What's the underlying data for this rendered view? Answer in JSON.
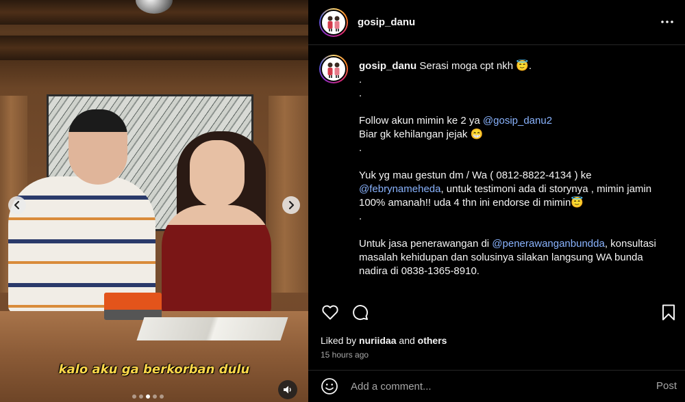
{
  "media": {
    "caption_overlay": "kalo aku ga berkorban dulu",
    "carousel": {
      "total": 5,
      "active_index": 2
    },
    "prev_icon": "chevron-left-icon",
    "next_icon": "chevron-right-icon",
    "sound_icon": "speaker-icon"
  },
  "header": {
    "username": "gosip_danu",
    "more_icon": "more-horizontal-icon",
    "more_label": "•••"
  },
  "caption": {
    "username": "gosip_danu",
    "lines": {
      "l1": "Serasi moga cpt nkh 😇.",
      "l2": ".",
      "l3": ".",
      "l4a": "Follow akun mimin ke 2 ya ",
      "l4_mention": "@gosip_danu2",
      "l5": "Biar gk kehilangan jejak 😁",
      "l6": ".",
      "l7": "Yuk yg mau gestun dm / Wa ( 0812-8822-4134 ) ke",
      "l8_mention": "@febrynameheda",
      "l8b": ", untuk testimoni ada di storynya , mimin jamin",
      "l9": "100% amanah!! uda 4 thn ini endorse di mimin😇",
      "l10": ".",
      "l11a": "Untuk jasa penerawangan di ",
      "l11_mention": "@penerawanganbundda",
      "l11b": ", konsultasi",
      "l12": "masalah kehidupan dan solusinya silakan langsung WA bunda",
      "l13": "nadira di 0838-1365-8910."
    }
  },
  "actions": {
    "like_icon": "heart-icon",
    "comment_icon": "comment-icon",
    "save_icon": "bookmark-icon"
  },
  "likes": {
    "prefix": "Liked by ",
    "user": "nuriidaa",
    "middle": " and ",
    "others": "others"
  },
  "timestamp": "15 hours ago",
  "comment_bar": {
    "emoji_icon": "smiley-icon",
    "placeholder": "Add a comment...",
    "post_label": "Post"
  }
}
